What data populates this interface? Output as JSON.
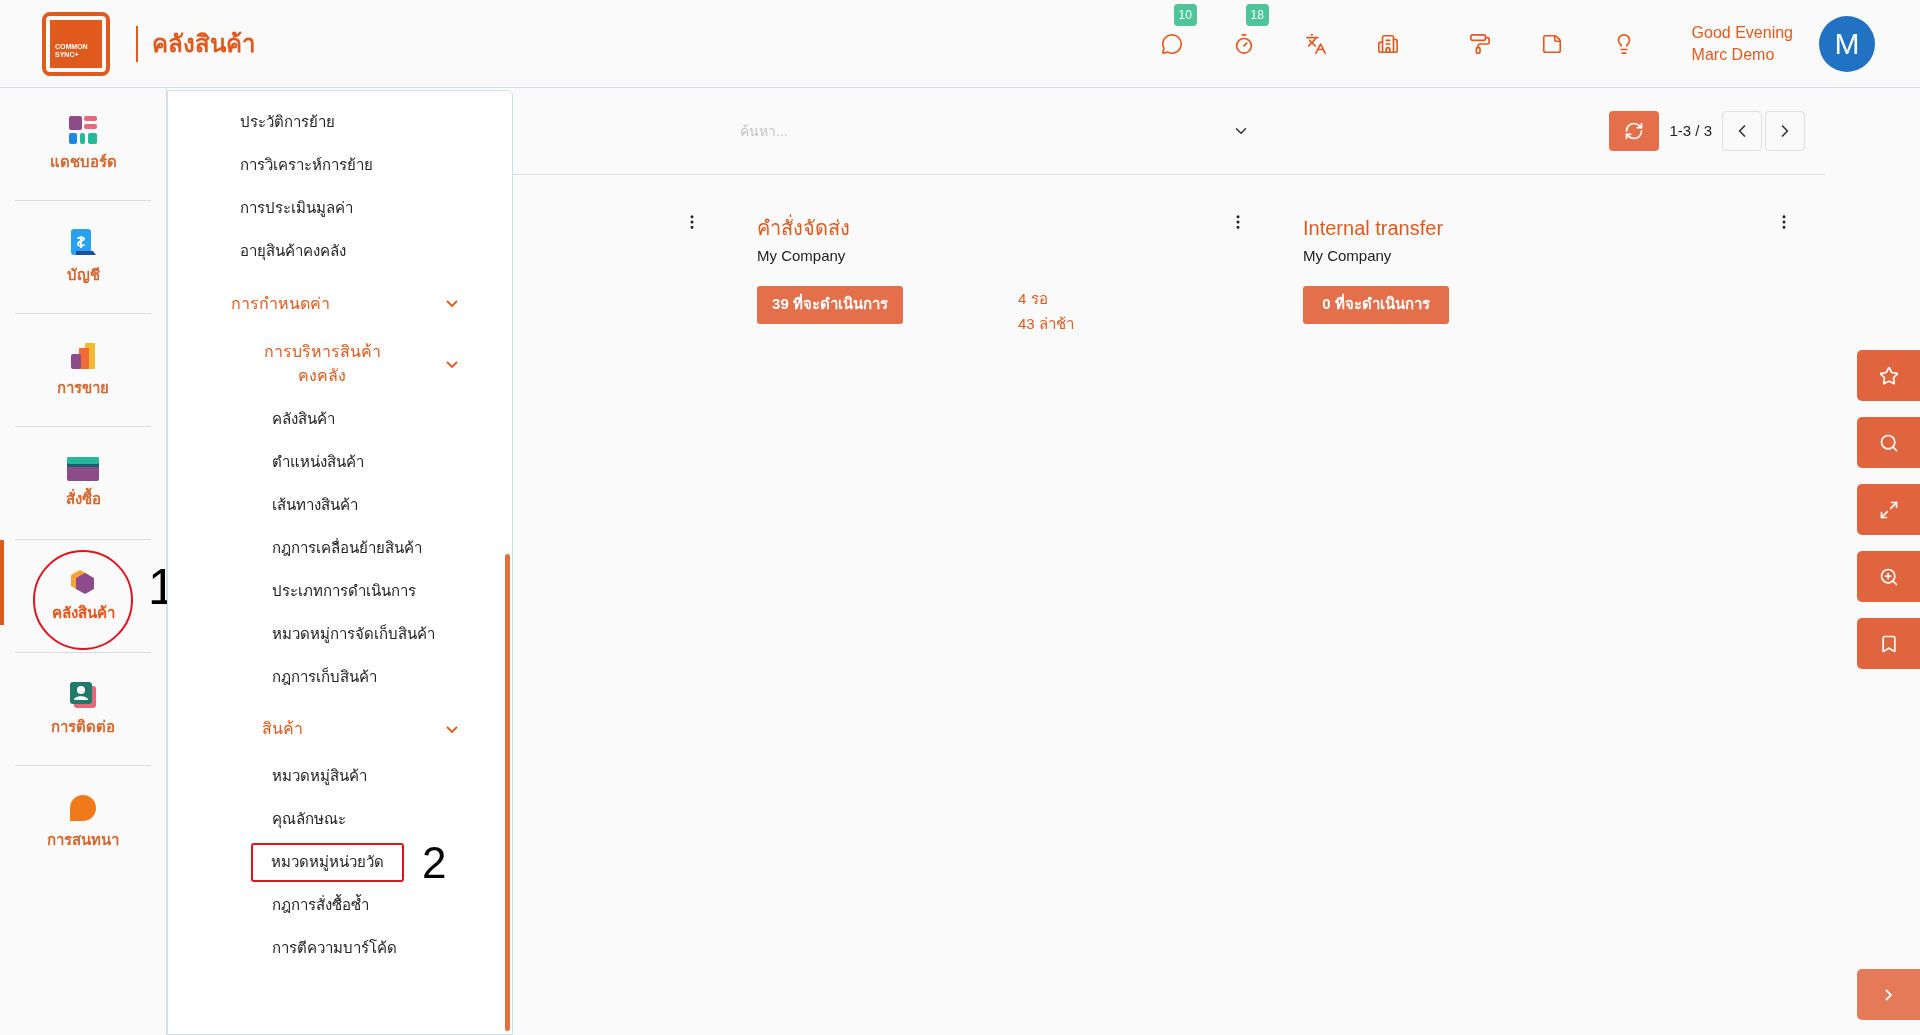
{
  "header": {
    "logo_lines": [
      "COMMON",
      "SYNC+"
    ],
    "title": "คลังสินค้า",
    "icon_badges": [
      {
        "kind": "chat",
        "badge": "10"
      },
      {
        "kind": "timer",
        "badge": "18"
      },
      {
        "kind": "translate"
      },
      {
        "kind": "building"
      },
      {
        "kind": "paint"
      },
      {
        "kind": "note"
      },
      {
        "kind": "bulb"
      }
    ],
    "greeting": [
      "Good Evening",
      "Marc Demo"
    ],
    "avatar": "M"
  },
  "sidebar": {
    "items": [
      {
        "kind": "dashboard",
        "label": "แดชบอร์ด",
        "selected": false
      },
      {
        "kind": "accounting",
        "label": "บัญชี",
        "selected": false
      },
      {
        "kind": "sales",
        "label": "การขาย",
        "selected": false
      },
      {
        "kind": "purchase",
        "label": "สั่งซื้อ",
        "selected": false
      },
      {
        "kind": "inventory",
        "label": "คลังสินค้า",
        "selected": true,
        "annotation": "1"
      },
      {
        "kind": "contacts",
        "label": "การติดต่อ",
        "selected": false
      },
      {
        "kind": "chat",
        "label": "การสนทนา",
        "selected": false
      }
    ]
  },
  "menu": {
    "items": [
      {
        "kind": "link",
        "label": "ประวัติการย้าย"
      },
      {
        "kind": "link",
        "label": "การวิเคราะห์การย้าย"
      },
      {
        "kind": "link",
        "label": "การประเมินมูลค่า"
      },
      {
        "kind": "link",
        "label": "อายุสินค้าคงคลัง"
      },
      {
        "kind": "group",
        "label": "การกำหนดค่า",
        "expanded": true,
        "children": [
          {
            "kind": "group",
            "label": "การบริหารสินค้าคงคลัง",
            "expanded": true,
            "children": [
              {
                "kind": "link",
                "label": "คลังสินค้า"
              },
              {
                "kind": "link",
                "label": "ตำแหน่งสินค้า"
              },
              {
                "kind": "link",
                "label": "เส้นทางสินค้า"
              },
              {
                "kind": "link",
                "label": "กฎการเคลื่อนย้ายสินค้า"
              },
              {
                "kind": "link",
                "label": "ประเภทการดำเนินการ"
              },
              {
                "kind": "link",
                "label": "หมวดหมู่การจัดเก็บสินค้า"
              },
              {
                "kind": "link",
                "label": "กฎการเก็บสินค้า"
              }
            ]
          },
          {
            "kind": "group",
            "label": "สินค้า",
            "expanded": true,
            "children": [
              {
                "kind": "link",
                "label": "หมวดหมู่สินค้า"
              },
              {
                "kind": "link",
                "label": "คุณลักษณะ"
              },
              {
                "kind": "link",
                "label": "หมวดหมู่หน่วยวัด",
                "annotation": "2"
              },
              {
                "kind": "link",
                "label": "กฎการสั่งซื้อซ้ำ"
              },
              {
                "kind": "link",
                "label": "การตีความบาร์โค้ด"
              }
            ]
          }
        ]
      }
    ]
  },
  "toolbar": {
    "search": {
      "placeholder": "ค้นหา..."
    },
    "pager": "1-3 / 3"
  },
  "cards": [
    {
      "kind": "hidden"
    },
    {
      "kind": "card",
      "title": "คำสั่งจัดส่ง",
      "company": "My Company",
      "action": "39 ที่จะดำเนินการ",
      "stats": [
        "4 รอ",
        "43 ล่าช้า"
      ]
    },
    {
      "kind": "card",
      "title": "Internal transfer",
      "company": "My Company",
      "action": "0 ที่จะดำเนินการ"
    }
  ],
  "side_tools": [
    {
      "kind": "star"
    },
    {
      "kind": "search"
    },
    {
      "kind": "expand"
    },
    {
      "kind": "zoom"
    },
    {
      "kind": "bookmark"
    }
  ]
}
